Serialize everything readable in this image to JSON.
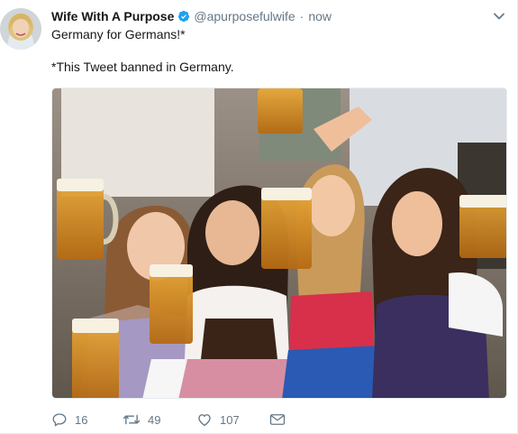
{
  "user": {
    "display_name": "Wife With A Purpose",
    "handle": "@apurposefulwife",
    "verified": true,
    "avatar_icon": "profile-photo"
  },
  "tweet": {
    "timestamp": "now",
    "separator": "·",
    "text_line1": "Germany for Germans!*",
    "text_line2": "*This Tweet banned in Germany.",
    "media_alt_icon": "photo-women-holding-beer-steins"
  },
  "actions": {
    "replies": "16",
    "retweets": "49",
    "likes": "107"
  },
  "colors": {
    "text": "#14171a",
    "secondary": "#657786",
    "verified_blue": "#1da1f2",
    "border": "#e6ecf0"
  }
}
